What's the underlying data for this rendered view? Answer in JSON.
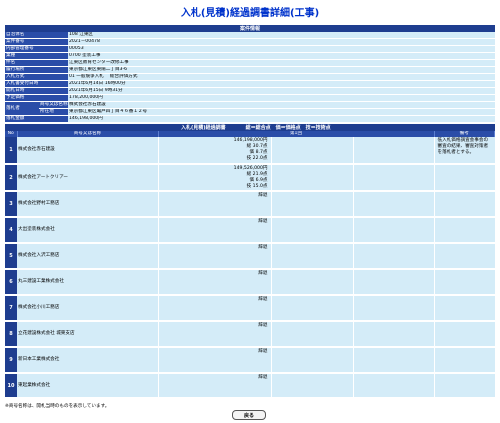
{
  "page_title": "入札(見積)経過調書詳細(工事)",
  "info": {
    "section_title": "案件情報",
    "rows": [
      {
        "label": "自治体名",
        "value": "108 江東区"
      },
      {
        "label": "案件番号",
        "value": "2021－00478"
      },
      {
        "label": "内部管理番号",
        "value": "00053"
      },
      {
        "label": "業種",
        "value": "0700 塗装工事"
      },
      {
        "label": "件名",
        "value": "江東区教育センター改修工事"
      },
      {
        "label": "履行場所",
        "value": "東京都江東区東陽二丁目3-6"
      },
      {
        "label": "入札方式",
        "value": "01 一般競争入札　 総合評価方式"
      },
      {
        "label": "入札書受付日時",
        "value": "2021年6月14日 16時00分"
      },
      {
        "label": "開札日時",
        "value": "2021年6月15日 9時31分"
      },
      {
        "label": "予定価格",
        "value": "178,200,000円"
      }
    ],
    "winner": {
      "label": "落札者",
      "name_label": "商号又は名称",
      "name_value": "株式会社赤石建設",
      "address_label": "所在地",
      "address_value": "東京都江東区亀戸四丁目４６番１２号"
    },
    "amount": {
      "label": "落札金額",
      "value": "146,198,000円"
    }
  },
  "results": {
    "title": "入札(見積)経過調書",
    "legend": "総＝総合点　価＝価格点　技＝技術点",
    "columns": {
      "no": "No",
      "name": "商号又は名称",
      "round": "第1回",
      "remarks": "備考"
    },
    "remarks_text": "低入札価格調査会事会の審査の結果、審査対策者を落札者とする。",
    "bidders": [
      {
        "no": "1",
        "name": "株式会社赤石建設",
        "lines": [
          "146,198,000円",
          "総 30.7点",
          "価 8.7点",
          "技 22.0点"
        ]
      },
      {
        "no": "2",
        "name": "株式会社アートクリアー",
        "lines": [
          "149,526,000円",
          "総 21.9点",
          "価 6.9点",
          "技 15.0点"
        ]
      },
      {
        "no": "3",
        "name": "株式会社野村工務店",
        "lines": [
          "辞退"
        ]
      },
      {
        "no": "4",
        "name": "大出塗装株式会社",
        "lines": [
          "辞退"
        ]
      },
      {
        "no": "5",
        "name": "株式会社入沢工務店",
        "lines": [
          "辞退"
        ]
      },
      {
        "no": "6",
        "name": "丸三建設工業株式会社",
        "lines": [
          "辞退"
        ]
      },
      {
        "no": "7",
        "name": "株式会社小川工務店",
        "lines": [
          "辞退"
        ]
      },
      {
        "no": "8",
        "name": "立花建設株式会社 城東支店",
        "lines": [
          "辞退"
        ]
      },
      {
        "no": "9",
        "name": "新日本工業株式会社",
        "lines": [
          "辞退"
        ]
      },
      {
        "no": "10",
        "name": "東起業株式会社",
        "lines": [
          "辞退"
        ]
      }
    ]
  },
  "footnote": "※商号名称は、開札当時のものを表示しています。",
  "back_button": "戻る"
}
